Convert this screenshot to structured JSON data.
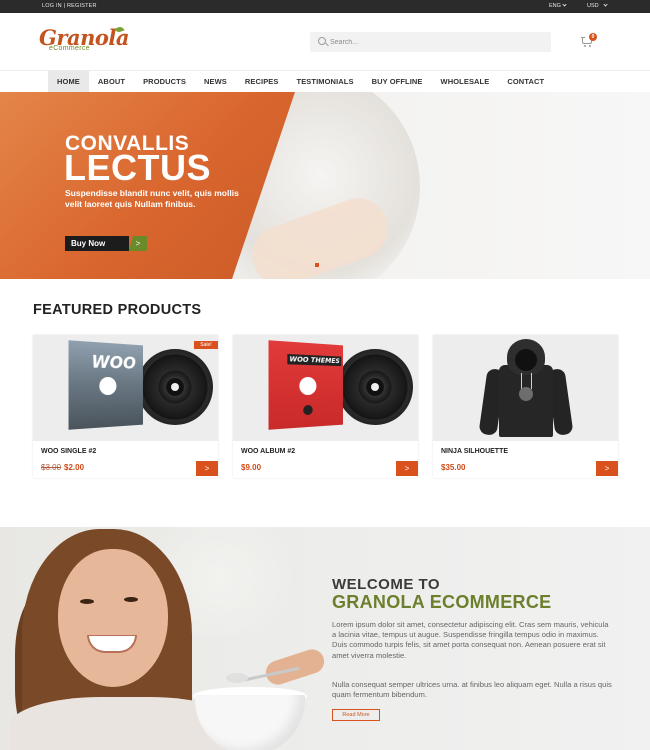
{
  "topbar": {
    "login": "LOG IN",
    "separator": "|",
    "register": "REGISTER",
    "language": "ENG",
    "currency": "USD"
  },
  "header": {
    "logo_word": "Granola",
    "logo_sub": "eCommerce",
    "search_placeholder": "Search...",
    "cart_count": "0"
  },
  "nav": {
    "items": [
      "HOME",
      "ABOUT",
      "PRODUCTS",
      "NEWS",
      "RECIPES",
      "TESTIMONIALS",
      "BUY OFFLINE",
      "WHOLESALE",
      "CONTACT"
    ],
    "active": "HOME"
  },
  "hero": {
    "kicker": "CONVALLIS",
    "title": "LECTUS",
    "description": "Suspendisse blandit nunc velit, quis mollis velit laoreet quis Nullam finibus.",
    "button_label": "Buy Now",
    "button_arrow": ">"
  },
  "featured": {
    "title": "FEATURED PRODUCTS",
    "products": [
      {
        "name": "WOO SINGLE #2",
        "old_price": "$3.00",
        "price": "$2.00",
        "sale_badge": "Sale!",
        "art_text": "WOO"
      },
      {
        "name": "WOO ALBUM #2",
        "old_price": "",
        "price": "$9.00",
        "sale_badge": "",
        "art_text": "WOO THEMES"
      },
      {
        "name": "NINJA SILHOUETTE",
        "old_price": "",
        "price": "$35.00",
        "sale_badge": "",
        "art_text": ""
      }
    ],
    "card_button": ">"
  },
  "welcome": {
    "kicker": "WELCOME TO",
    "title": "GRANOLA ECOMMERCE",
    "paragraph1": "Lorem ipsum dolor sit amet, consectetur adipiscing elit. Cras sem mauris, vehicula a lacinia vitae, tempus ut augue. Suspendisse fringilla tempus odio in maximus. Duis commodo turpis felis, sit amet porta consequat non. Aenean posuere erat sit amet viverra molestie.",
    "paragraph2": "Nulla consequat semper ultrices urna. at finibus leo aliquam eget. Nulla a risus quis quam fermentum bibendum.",
    "button_label": "Read More"
  },
  "colors": {
    "accent": "#d9521e",
    "brand_green": "#6b7f2c",
    "topbar": "#2b2b2b"
  }
}
